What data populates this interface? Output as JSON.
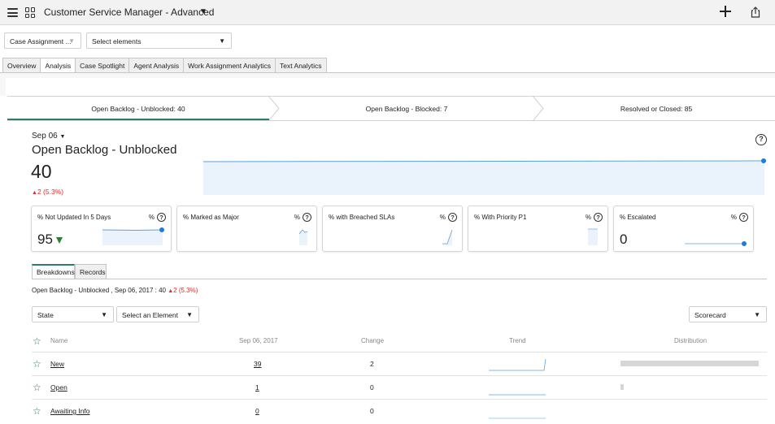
{
  "header": {
    "title": "Customer Service Manager - Advanced",
    "icons": {
      "menu": "hamburger-icon",
      "apps": "grid-icon",
      "add": "plus-icon",
      "share": "share-icon",
      "title_caret": "chevron-down-icon"
    }
  },
  "filters": {
    "dashboard_select": "Case Assignment ...",
    "elements_select": "Select elements"
  },
  "tabs": [
    "Overview",
    "Analysis",
    "Case Spotlight",
    "Agent Analysis",
    "Work Assignment Analytics",
    "Text Analytics"
  ],
  "active_tab": "Analysis",
  "stepper": {
    "steps": [
      {
        "label": "Open Backlog - Unblocked: 40",
        "active": true
      },
      {
        "label": "Open Backlog - Blocked: 7",
        "active": false
      },
      {
        "label": "Resolved or Closed: 85",
        "active": false
      }
    ]
  },
  "summary": {
    "date": "Sep 06",
    "title": "Open Backlog - Unblocked",
    "value": "40",
    "delta": "2 (5.3%)",
    "delta_direction": "up",
    "help": "?"
  },
  "cards": [
    {
      "title": "% Not Updated In 5 Days",
      "unit": "%",
      "help": "?",
      "value": "95",
      "trend": "down"
    },
    {
      "title": "% Marked as Major",
      "unit": "%",
      "help": "?",
      "value": ""
    },
    {
      "title": "% with Breached SLAs",
      "unit": "%",
      "help": "?",
      "value": ""
    },
    {
      "title": "% With Priority P1",
      "unit": "%",
      "help": "?",
      "value": ""
    },
    {
      "title": "% Escalated",
      "unit": "%",
      "help": "?",
      "value": "0"
    }
  ],
  "breakdown_tabs": [
    "Breakdowns",
    "Records"
  ],
  "active_breakdown_tab": "Breakdowns",
  "breakdown_summary": {
    "text": "Open Backlog - Unblocked , Sep 06, 2017 : 40",
    "delta": "2 (5.3%)"
  },
  "breakdown_filters": {
    "state": "State",
    "element": "Select an Element",
    "view": "Scorecard"
  },
  "table": {
    "headers": {
      "name": "Name",
      "date": "Sep 06, 2017",
      "change": "Change",
      "trend": "Trend",
      "distribution": "Distribution"
    },
    "rows": [
      {
        "name": "New",
        "value": "39",
        "change": "2",
        "distribution": 0.975
      },
      {
        "name": "Open",
        "value": "1",
        "change": "0",
        "distribution": 0.025
      },
      {
        "name": "Awaiting Info",
        "value": "0",
        "change": "0",
        "distribution": 0
      }
    ]
  },
  "colors": {
    "accent": "#2b7e6b",
    "spark_line": "#5aa0dc",
    "spark_fill": "#eaf3fb",
    "spark_dot": "#1f7ae0",
    "negative": "#d62e2e",
    "positive_arrow": "#2e7d32"
  }
}
